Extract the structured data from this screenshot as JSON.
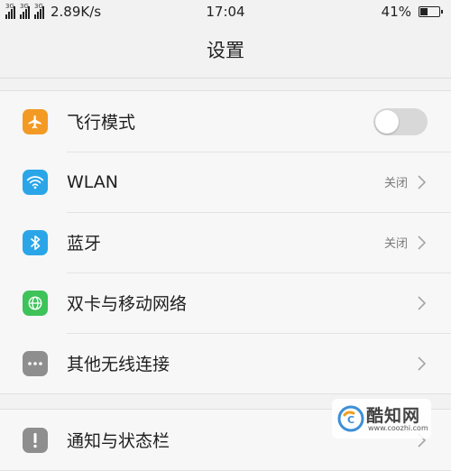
{
  "statusbar": {
    "network_1": "3G",
    "network_2": "3G",
    "network_3": "3G",
    "speed": "2.89K/s",
    "time": "17:04",
    "battery": "41%",
    "battery_level": 0.41
  },
  "header": {
    "title": "设置"
  },
  "groups": [
    {
      "items": [
        {
          "label": "飞行模式",
          "icon": "airplane-icon",
          "color": "#f39a24",
          "control": "toggle",
          "toggle_on": false
        },
        {
          "label": "WLAN",
          "icon": "wifi-icon",
          "color": "#2aa6e8",
          "status": "关闭"
        },
        {
          "label": "蓝牙",
          "icon": "bluetooth-icon",
          "color": "#2aa6e8",
          "status": "关闭"
        },
        {
          "label": "双卡与移动网络",
          "icon": "globe-icon",
          "color": "#3ec25a"
        },
        {
          "label": "其他无线连接",
          "icon": "more-icon",
          "color": "#8e8e8e"
        }
      ]
    },
    {
      "items": [
        {
          "label": "通知与状态栏",
          "icon": "notification-icon",
          "color": "#8e8e8e"
        }
      ]
    }
  ],
  "watermark": {
    "name": "酷知网",
    "url": "www.coozhi.com"
  }
}
